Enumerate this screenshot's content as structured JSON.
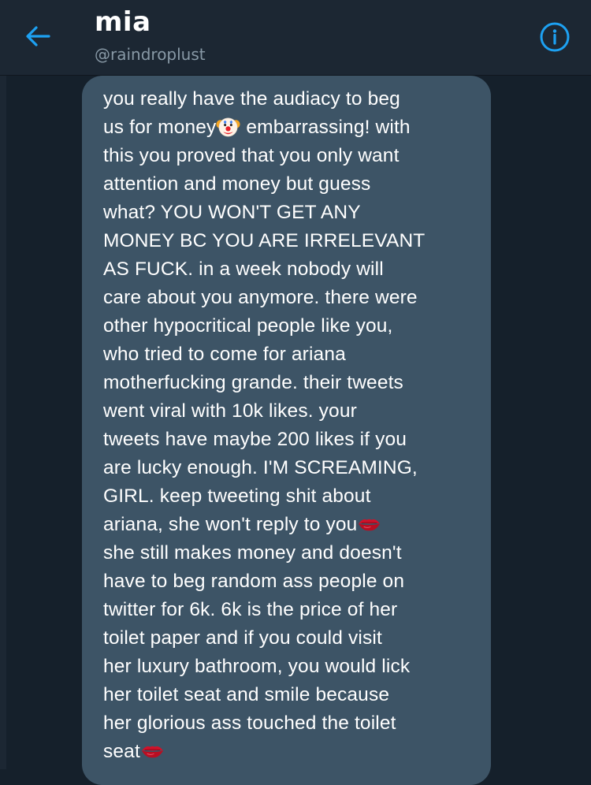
{
  "header": {
    "title": "mia",
    "handle": "@raindroplust"
  },
  "colors": {
    "background": "#15202b",
    "header": "#1c2733",
    "bubble": "#3d5466",
    "accent": "#1da1f2",
    "muted_text": "#8899a6"
  },
  "icons": {
    "back": "back-arrow-icon",
    "info": "info-icon",
    "clown": "clown-face-emoji",
    "kiss": "kiss-mark-emoji"
  },
  "message": {
    "lines": [
      {
        "text": "you really have the audiacy to beg"
      },
      {
        "text": "us for money",
        "emoji": "clown",
        "after": " embarrassing! with"
      },
      {
        "text": "this you proved that you only want"
      },
      {
        "text": "attention and money but guess"
      },
      {
        "text": "what? YOU WON'T GET ANY"
      },
      {
        "text": "MONEY BC YOU ARE IRRELEVANT"
      },
      {
        "text": "AS FUCK. in a week nobody will"
      },
      {
        "text": "care about you anymore. there were"
      },
      {
        "text": "other hypocritical people like you,"
      },
      {
        "text": "who tried to come for ariana"
      },
      {
        "text": "motherfucking grande. their tweets"
      },
      {
        "text": "went viral with 10k likes. your"
      },
      {
        "text": "tweets have maybe 200 likes if you"
      },
      {
        "text": "are lucky enough. I'M SCREAMING,"
      },
      {
        "text": "GIRL. keep tweeting shit about"
      },
      {
        "text": "ariana, she won't reply to you",
        "emoji": "kiss"
      },
      {
        "text": "she still makes money and doesn't"
      },
      {
        "text": "have to beg random ass people on"
      },
      {
        "text": "twitter for 6k. 6k is the price of her"
      },
      {
        "text": "toilet paper and if you could visit"
      },
      {
        "text": "her luxury bathroom, you would lick"
      },
      {
        "text": "her toilet seat and smile because"
      },
      {
        "text": "her glorious ass touched the toilet"
      },
      {
        "text": "seat",
        "emoji": "kiss"
      }
    ]
  }
}
